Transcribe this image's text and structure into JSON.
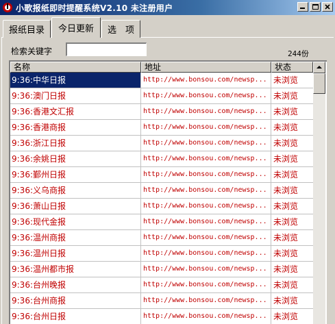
{
  "window": {
    "title": "小歌报纸即时提醒系统V2.10   未注册用户",
    "min_glyph": "_",
    "max_glyph": "□",
    "close_glyph": "✕"
  },
  "tabs": [
    {
      "label": "报纸目录",
      "active": false
    },
    {
      "label": "今日更新",
      "active": true
    },
    {
      "label": "选　项",
      "active": false
    }
  ],
  "search": {
    "label": "检索关键字",
    "value": "",
    "count": "244份"
  },
  "table": {
    "columns": [
      "名称",
      "地址",
      "状态"
    ],
    "rows": [
      {
        "name": "9:36:中华日报",
        "url": "http://www.bonsou.com/newsp...",
        "status": "未浏览",
        "selected": true
      },
      {
        "name": "9:36:澳门日报",
        "url": "http://www.bonsou.com/newsp...",
        "status": "未浏览"
      },
      {
        "name": "9:36:香港文汇报",
        "url": "http://www.bonsou.com/newsp...",
        "status": "未浏览"
      },
      {
        "name": "9:36:香港商报",
        "url": "http://www.bonsou.com/newsp...",
        "status": "未浏览"
      },
      {
        "name": "9:36:浙江日报",
        "url": "http://www.bonsou.com/newsp...",
        "status": "未浏览"
      },
      {
        "name": "9:36:余姚日报",
        "url": "http://www.bonsou.com/newsp...",
        "status": "未浏览"
      },
      {
        "name": "9:36:鄞州日报",
        "url": "http://www.bonsou.com/newsp...",
        "status": "未浏览"
      },
      {
        "name": "9:36:义乌商报",
        "url": "http://www.bonsou.com/newsp...",
        "status": "未浏览"
      },
      {
        "name": "9:36:萧山日报",
        "url": "http://www.bonsou.com/newsp...",
        "status": "未浏览"
      },
      {
        "name": "9:36:现代金报",
        "url": "http://www.bonsou.com/newsp...",
        "status": "未浏览"
      },
      {
        "name": "9:36:温州商报",
        "url": "http://www.bonsou.com/newsp...",
        "status": "未浏览"
      },
      {
        "name": "9:36:温州日报",
        "url": "http://www.bonsou.com/newsp...",
        "status": "未浏览"
      },
      {
        "name": "9:36:温州都市报",
        "url": "http://www.bonsou.com/newsp...",
        "status": "未浏览"
      },
      {
        "name": "9:36:台州晚报",
        "url": "http://www.bonsou.com/newsp...",
        "status": "未浏览"
      },
      {
        "name": "9:36:台州商报",
        "url": "http://www.bonsou.com/newsp...",
        "status": "未浏览"
      },
      {
        "name": "9:36:台州日报",
        "url": "http://www.bonsou.com/newsp...",
        "status": "未浏览"
      }
    ]
  },
  "colors": {
    "row_text": "#c00000",
    "selection": "#0a246a",
    "titlebar_start": "#0a246a",
    "titlebar_end": "#a6caf0"
  }
}
